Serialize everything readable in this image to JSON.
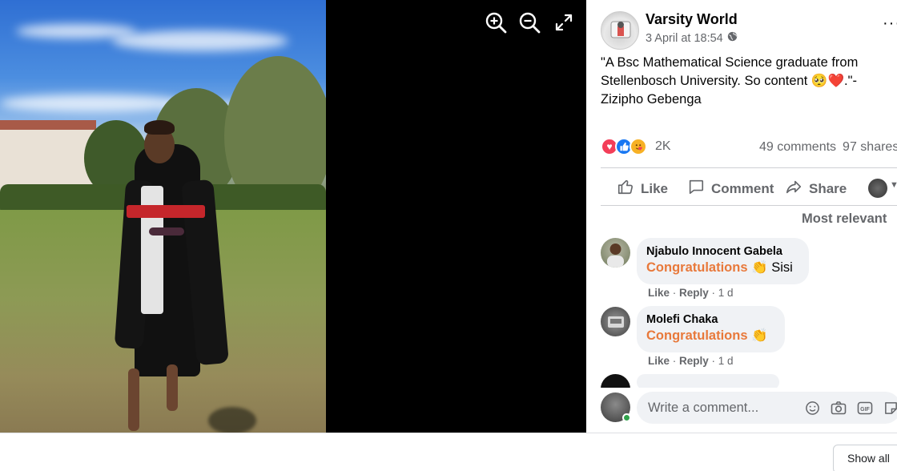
{
  "post": {
    "author": "Varsity World",
    "timestamp": "3 April at 18:54",
    "privacy_icon": "globe-icon",
    "more_label": "···",
    "caption_quote": "\"A Bsc Mathematical Science graduate from Stellenbosch University. So content ",
    "caption_emoji": "🥺❤️",
    "caption_attrib": ".\"- Zizipho Gebenga",
    "reaction_count": "2K",
    "comments_count": "49 comments",
    "shares_count": "97 shares",
    "reactions": [
      "love-reaction-icon",
      "like-reaction-icon",
      "care-reaction-icon"
    ]
  },
  "actions": {
    "like": "Like",
    "comment": "Comment",
    "share": "Share"
  },
  "sort": {
    "label": "Most relevant"
  },
  "comments": [
    {
      "name": "Njabulo Innocent Gabela",
      "highlight": "Congratulations",
      "emoji": "👏",
      "text": "Sisi",
      "like": "Like",
      "reply": "Reply",
      "age": "1 d"
    },
    {
      "name": "Molefi Chaka",
      "highlight": "Congratulations",
      "emoji": "👏",
      "text": "",
      "like": "Like",
      "reply": "Reply",
      "age": "1 d"
    }
  ],
  "composer": {
    "placeholder": "Write a comment...",
    "icons": [
      "emoji-icon",
      "camera-icon",
      "gif-icon",
      "sticker-icon"
    ]
  },
  "viewer": {
    "icons": [
      "zoom-in-icon",
      "zoom-out-icon",
      "fullscreen-icon"
    ]
  },
  "footer": {
    "show_all": "Show all"
  },
  "colors": {
    "highlight": "#e8793b",
    "secondary_text": "#65676b",
    "bubble": "#f0f2f5",
    "love": "#f33e58",
    "like": "#1877f2",
    "care": "#f7b125"
  }
}
